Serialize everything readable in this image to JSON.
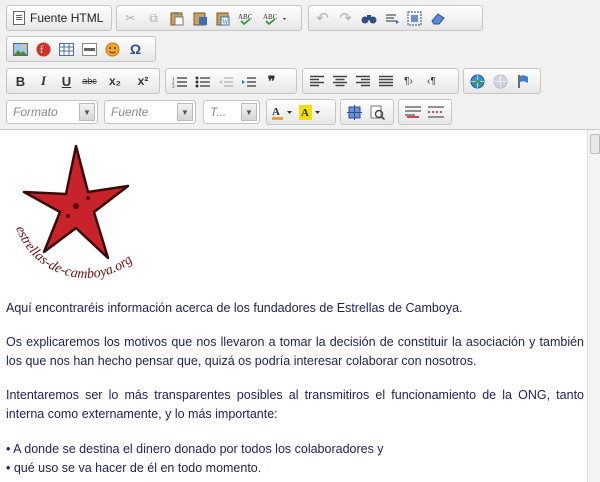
{
  "toolbar": {
    "source_label": "Fuente HTML",
    "format_placeholder": "Formato",
    "font_placeholder": "Fuente",
    "size_placeholder": "T...",
    "bold": "B",
    "italic": "I",
    "underline": "U",
    "strike": "abc",
    "subscript": "x₂",
    "superscript": "x²",
    "quote": "❞",
    "colors": {
      "text_color": "#e8a33a",
      "bg_color": "#f2e000",
      "accent_blue": "#2c6fbf",
      "star_red": "#c8232a"
    }
  },
  "logo": {
    "text": "estrellas-de-camboya.org"
  },
  "content": {
    "p1": "Aquí encontraréis información acerca de los fundadores de Estrellas de Camboya.",
    "p2": "Os explicaremos los motivos que nos llevaron a tomar la decisión de constituir la asociación y también los que nos han hecho pensar que, quizá os podría interesar colaborar con nosotros.",
    "p3": "Intentaremos ser lo más transparentes posibles al transmitiros el funcionamiento de la ONG, tanto interna como externamente, y lo más importante:",
    "bullet1": "• A donde se destina el dinero donado por todos los colaboradores y",
    "bullet2": "• qué uso se va hacer de él en todo momento."
  }
}
